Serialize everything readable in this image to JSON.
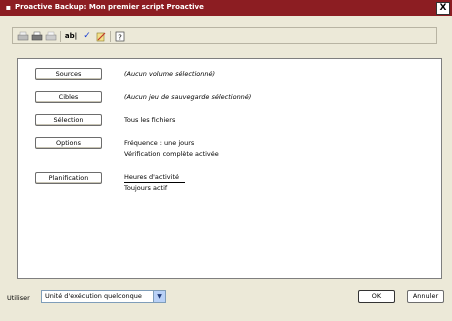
{
  "window": {
    "title": "Proactive Backup: Mon premier script Proactive",
    "close_label": "X",
    "title_icon": "app-icon"
  },
  "toolbar": {
    "icons": [
      "print-preview-icon",
      "print-icon",
      "page-setup-icon",
      "rename-icon",
      "check-icon",
      "edit-icon",
      "help-icon"
    ],
    "rename_glyph": "ab|",
    "check_glyph": "✓"
  },
  "script": {
    "rows": [
      {
        "button": "Sources",
        "desc": "(Aucun volume sélectionné)"
      },
      {
        "button": "Cibles",
        "desc": "(Aucun jeu de sauvegarde sélectionné)"
      },
      {
        "button": "Sélection",
        "desc": "Tous les fichiers"
      },
      {
        "button": "Options",
        "desc_line1": "Fréquence : une jours",
        "desc_line2": "Vérification complète activée"
      },
      {
        "button": "Planification",
        "desc_line1": "Heures d'activité",
        "desc_line2": "Toujours actif"
      }
    ]
  },
  "bottom": {
    "use_label": "Utiliser",
    "execution_unit": "Unité d'exécution quelconque",
    "ok_label": "OK",
    "cancel_label": "Annuler"
  }
}
